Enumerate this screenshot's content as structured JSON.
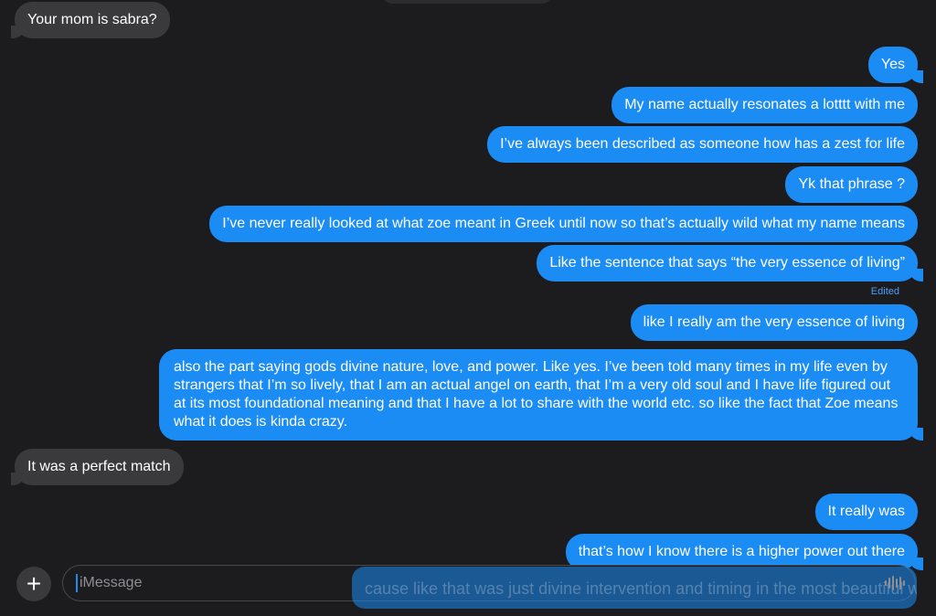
{
  "messages": [
    {
      "side": "in",
      "text": "Your mom is sabra?"
    },
    {
      "side": "out",
      "text": "Yes"
    },
    {
      "side": "out",
      "text": "My name actually resonates a lotttt with me"
    },
    {
      "side": "out",
      "text": "I’ve always been described as someone how has a zest for life"
    },
    {
      "side": "out",
      "text": "Yk that phrase ?"
    },
    {
      "side": "out",
      "text": "I’ve never really looked at what zoe meant in Greek until now so that’s actually wild what my name means"
    },
    {
      "side": "out",
      "text": "Like the sentence that says “the very essence of living”"
    },
    {
      "side": "out",
      "text": "like I really am the very essence of living"
    },
    {
      "side": "out",
      "text": "also the part saying gods divine nature, love, and power. Like yes. I’ve been told many times in my life even by strangers that I’m so lively, that I am an actual angel on earth, that I’m a very old soul and I have life figured out at its most foundational meaning and that I have a lot to share with the world etc. so like the fact that Zoe means what it does is kinda crazy."
    },
    {
      "side": "in",
      "text": "It was a perfect match"
    },
    {
      "side": "out",
      "text": "It really was"
    },
    {
      "side": "out",
      "text": "that’s how I know there is a higher power out there"
    }
  ],
  "edited_label": "Edited",
  "compose": {
    "placeholder": "iMessage",
    "plus_symbol": "+",
    "sending_text": "cause like that was just divine intervention and timing in the most beautiful way"
  },
  "icons": {
    "plus": "plus-icon",
    "audio": "waveform-icon"
  },
  "colors": {
    "background": "#1c1c1e",
    "outgoing": "#1c8cf5",
    "incoming": "#3a3a3c"
  }
}
